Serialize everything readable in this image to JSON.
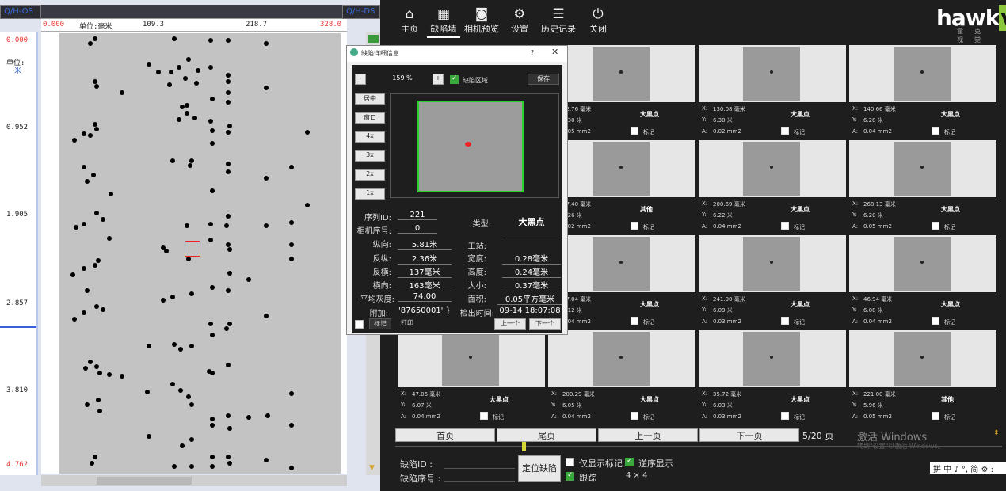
{
  "map": {
    "corner_left": "Q/H-OS",
    "corner_right": "Q/H-DS",
    "ruler_ticks": [
      "0.000",
      "单位:毫米",
      "109.3",
      "218.7",
      "328.0"
    ],
    "unit_label": "单位:",
    "unit_value": "米",
    "vertical_ticks": [
      "0.000",
      "0.952",
      "1.905",
      "2.857",
      "3.810",
      "4.762"
    ]
  },
  "toolbar": {
    "home": "主页",
    "defect_wall": "缺陷墙",
    "camera_preview": "相机预览",
    "settings": "设置",
    "history": "历史记录",
    "close": "关闭",
    "icons": {
      "home": "home-icon",
      "defect_wall": "grid-icon",
      "camera": "camera-icon",
      "settings": "gear-icon",
      "history": "list-icon",
      "close": "power-icon"
    }
  },
  "logo": {
    "text_a": "hawk",
    "text_b": "vis",
    "sub": "霍克视觉"
  },
  "dialog": {
    "title": "缺陷详细信息",
    "help": "?",
    "close": "✕",
    "minus": "-",
    "zoom": "159 %",
    "plus": "+",
    "defect_area_label": "缺陷区域",
    "save": "保存",
    "side_buttons": [
      "居中",
      "窗口",
      "4x",
      "3x",
      "2x",
      "1x"
    ],
    "fields": {
      "serial_id_label": "序列ID:",
      "serial_id": "221",
      "camera_label": "相机序号:",
      "camera": "0",
      "type_label": "类型:",
      "type": "大黑点",
      "longitudinal_label": "纵向:",
      "longitudinal": "5.81米",
      "station_label": "工站:",
      "station": "",
      "rev_long_label": "反纵:",
      "rev_long": "2.36米",
      "width_label": "宽度:",
      "width": "0.28毫米",
      "rev_lat_label": "反横:",
      "rev_lat": "137毫米",
      "height_label": "高度:",
      "height": "0.24毫米",
      "lateral_label": "横向:",
      "lateral": "163毫米",
      "size_label": "大小:",
      "size": "0.37毫米",
      "gray_label": "平均灰度:",
      "gray": "74.00",
      "area_label": "面积:",
      "area": "0.05平方毫米",
      "extra_label": "附加:",
      "extra": "'87650001' }",
      "time_label": "检出时间:",
      "time": "09-14 18:07:08"
    },
    "mark": "标记",
    "print": "打印",
    "prev": "上一个",
    "next": "下一个"
  },
  "grid": [
    {
      "x": "62.76 毫米",
      "y": "6.30 米",
      "a": "0.05 mm2",
      "type": "大黑点"
    },
    {
      "x": "130.08 毫米",
      "y": "6.30 米",
      "a": "0.02 mm2",
      "type": "大黑点"
    },
    {
      "x": "140.66 毫米",
      "y": "6.28 米",
      "a": "0.04 mm2",
      "type": "大黑点"
    },
    {
      "x": "57.40 毫米",
      "y": "6.26 米",
      "a": "0.02 mm2",
      "type": "其他"
    },
    {
      "x": "200.69 毫米",
      "y": "6.22 米",
      "a": "0.04 mm2",
      "type": "大黑点"
    },
    {
      "x": "268.13 毫米",
      "y": "6.20 米",
      "a": "0.05 mm2",
      "type": "大黑点"
    },
    {
      "x": "57.04 毫米",
      "y": "6.12 米",
      "a": "0.04 mm2",
      "type": "大黑点"
    },
    {
      "x": "241.90 毫米",
      "y": "6.09 米",
      "a": "0.03 mm2",
      "type": "大黑点"
    },
    {
      "x": "46.94 毫米",
      "y": "6.08 米",
      "a": "0.04 mm2",
      "type": "大黑点"
    },
    {
      "x": "47.06 毫米",
      "y": "6.07 米",
      "a": "0.04 mm2",
      "type": "大黑点"
    },
    {
      "x": "200.29 毫米",
      "y": "6.05 米",
      "a": "0.04 mm2",
      "type": "大黑点"
    },
    {
      "x": "35.72 毫米",
      "y": "6.03 米",
      "a": "0.03 mm2",
      "type": "大黑点"
    },
    {
      "x": "221.00 毫米",
      "y": "5.96 米",
      "a": "0.05 mm2",
      "type": "其他"
    }
  ],
  "grid_labels": {
    "x": "X:",
    "y": "Y:",
    "a": "A:",
    "mark": "标记"
  },
  "pager": {
    "first": "首页",
    "last": "尾页",
    "prev": "上一页",
    "next": "下一页",
    "page": "5/20 页"
  },
  "watermark": {
    "line1": "激活 Windows",
    "line2": "转到\"设置\"以激活 Windows。"
  },
  "bottom": {
    "defect_id_label": "缺陷ID :",
    "defect_seq_label": "缺陷序号 :",
    "locate": "定位缺陷",
    "only_marked": "仅显示标记",
    "reverse": "逆序显示",
    "track": "跟踪",
    "grid_size": "4 × 4"
  },
  "ime": "拼 中 ♪ °, 简 ⚙ :"
}
